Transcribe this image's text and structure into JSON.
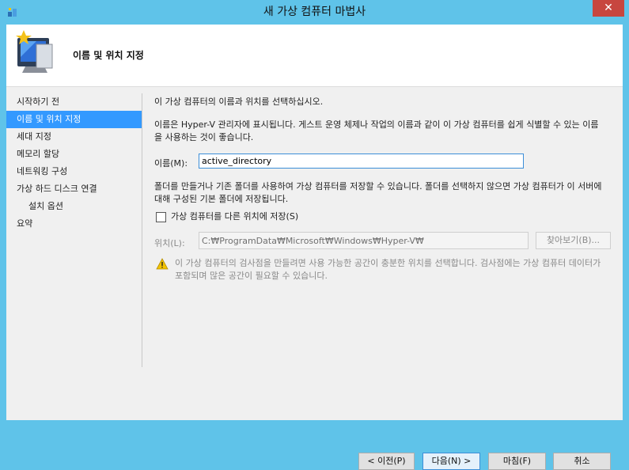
{
  "window": {
    "title": "새 가상 컴퓨터 마법사",
    "close_glyph": "✕"
  },
  "header": {
    "title": "이름 및 위치 지정"
  },
  "sidebar": {
    "items": [
      {
        "label": "시작하기 전"
      },
      {
        "label": "이름 및 위치 지정"
      },
      {
        "label": "세대 지정"
      },
      {
        "label": "메모리 할당"
      },
      {
        "label": "네트워킹 구성"
      },
      {
        "label": "가상 하드 디스크 연결"
      },
      {
        "label": "설치 옵션"
      },
      {
        "label": "요약"
      }
    ]
  },
  "content": {
    "intro": "이 가상 컴퓨터의 이름과 위치를 선택하십시오.",
    "name_desc": "이름은 Hyper-V 관리자에 표시됩니다. 게스트 운영 체제나 작업의 이름과 같이 이 가상 컴퓨터를 쉽게 식별할 수 있는 이름을 사용하는 것이 좋습니다.",
    "name_label": "이름(M):",
    "name_value": "active_directory",
    "folder_desc": "폴더를 만들거나 기존 폴더를 사용하여 가상 컴퓨터를 저장할 수 있습니다. 폴더를 선택하지 않으면 가상 컴퓨터가 이 서버에 대해 구성된 기본 폴더에 저장됩니다.",
    "store_checkbox_label": "가상 컴퓨터를 다른 위치에 저장(S)",
    "store_checked": false,
    "location_label": "위치(L):",
    "location_value": "C:₩ProgramData₩Microsoft₩Windows₩Hyper-V₩",
    "browse_label": "찾아보기(B)...",
    "warning_text": "이 가상 컴퓨터의 검사점을 만들려면 사용 가능한 공간이 충분한 위치를 선택합니다. 검사점에는 가상 컴퓨터 데이터가 포함되며 많은 공간이 필요할 수 있습니다."
  },
  "footer": {
    "prev_label": "< 이전(P)",
    "next_label": "다음(N) >",
    "finish_label": "마침(F)",
    "cancel_label": "취소"
  },
  "colors": {
    "frame": "#5fc3e9",
    "close": "#c7463f",
    "selection": "#3399ff",
    "focus_border": "#3c8ed8"
  }
}
